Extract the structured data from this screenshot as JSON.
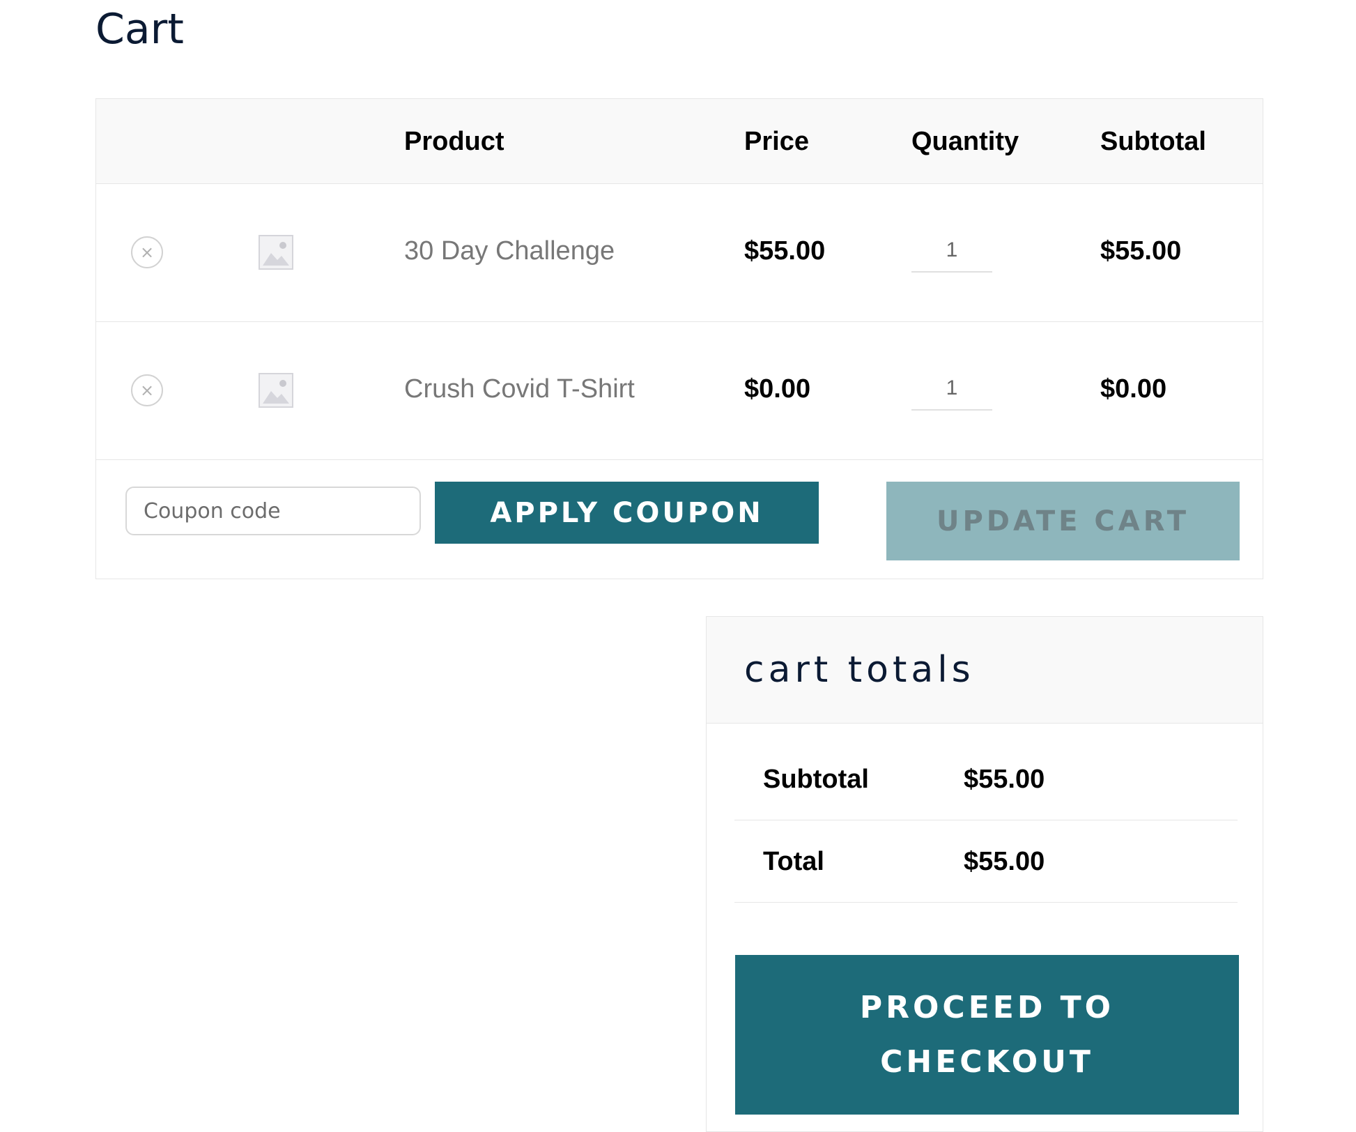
{
  "page": {
    "title": "Cart"
  },
  "cart": {
    "headers": {
      "product": "Product",
      "price": "Price",
      "quantity": "Quantity",
      "subtotal": "Subtotal"
    },
    "items": [
      {
        "name": "30 Day Challenge",
        "price": "$55.00",
        "quantity": "1",
        "subtotal": "$55.00",
        "remove_icon": "×"
      },
      {
        "name": "Crush Covid T-Shirt",
        "price": "$0.00",
        "quantity": "1",
        "subtotal": "$0.00",
        "remove_icon": "×"
      }
    ],
    "coupon": {
      "placeholder": "Coupon code",
      "value": ""
    },
    "apply_coupon_label": "Apply coupon",
    "update_cart_label": "Update cart"
  },
  "totals": {
    "title": "cart totals",
    "rows": [
      {
        "label": "Subtotal",
        "value": "$55.00"
      },
      {
        "label": "Total",
        "value": "$55.00"
      }
    ],
    "checkout_label": "Proceed to checkout"
  },
  "colors": {
    "accent": "#1d6b79",
    "accent_disabled": "#8eb6bc",
    "title": "#0b1a33",
    "header_bg": "#f9f9f9",
    "border": "#e6e6e6"
  },
  "icons": {
    "remove": "remove-circle-x-icon",
    "thumbnail": "image-placeholder-icon"
  }
}
